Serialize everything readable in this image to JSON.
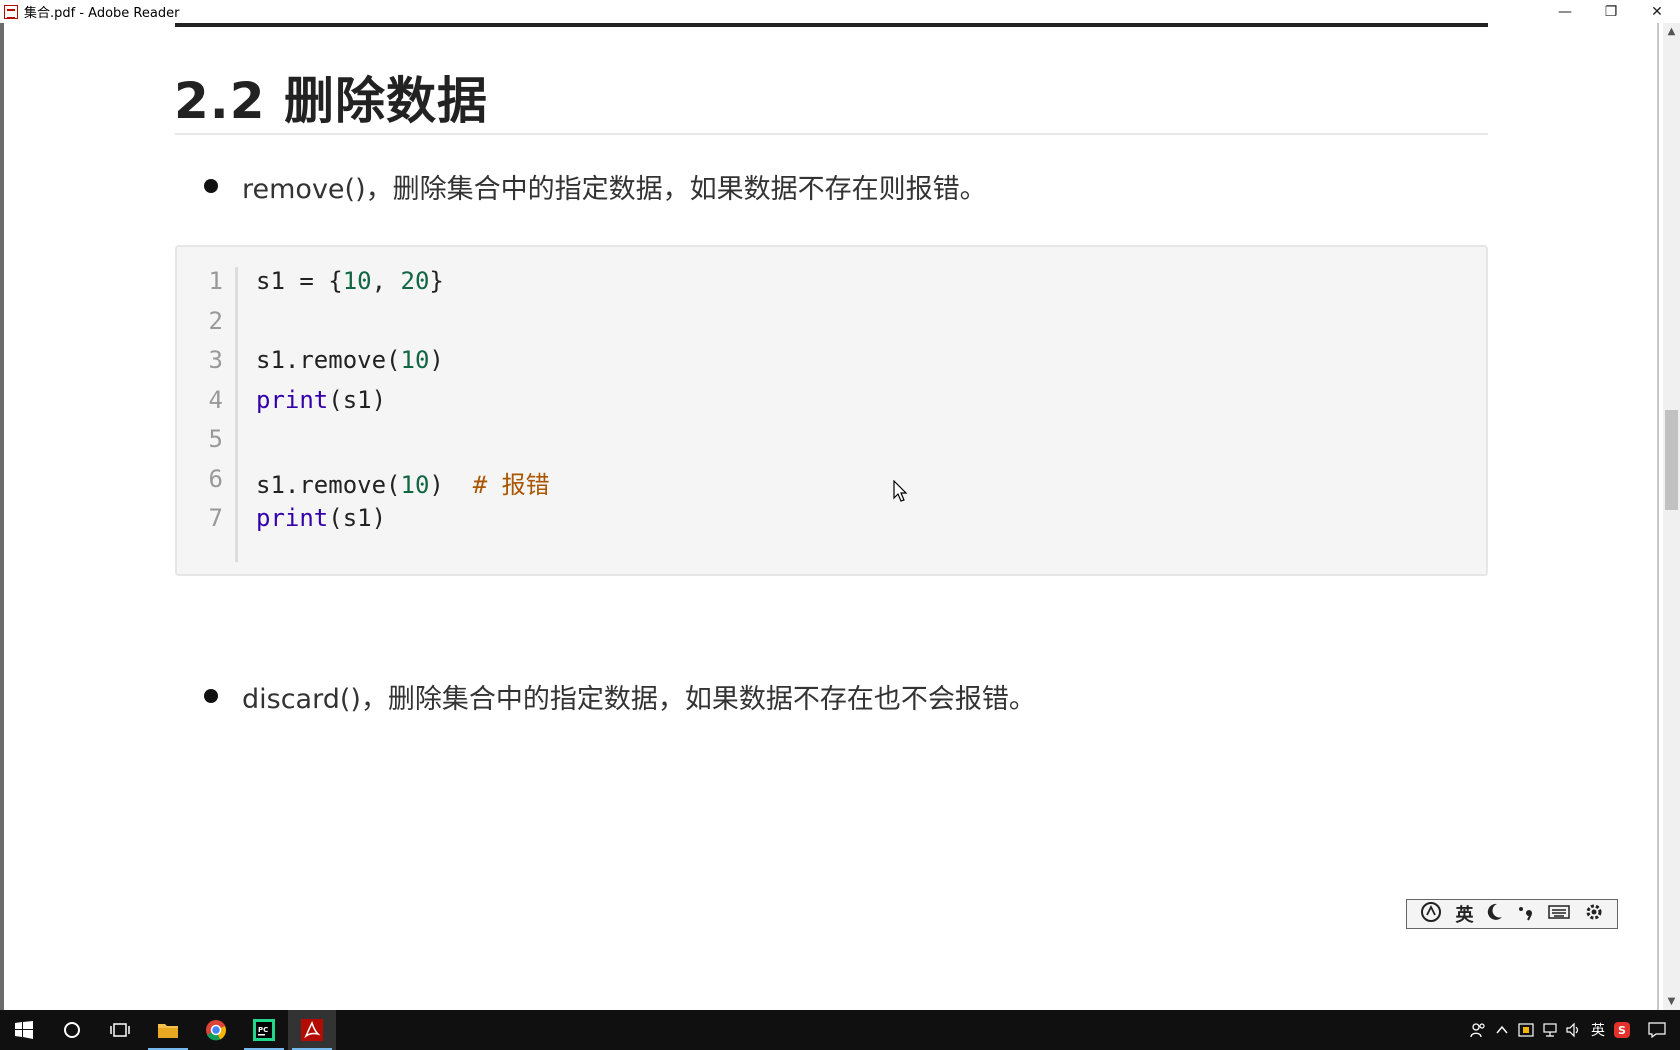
{
  "window": {
    "title": "集合.pdf - Adobe Reader",
    "minimize_glyph": "—",
    "restore_glyph": "❐",
    "close_glyph": "✕"
  },
  "document": {
    "heading": "2.2 删除数据",
    "bullets": [
      "remove()，删除集合中的指定数据，如果数据不存在则报错。",
      "discard()，删除集合中的指定数据，如果数据不存在也不会报错。"
    ],
    "code": {
      "line_numbers": [
        "1",
        "2",
        "3",
        "4",
        "5",
        "6",
        "7"
      ],
      "lines": [
        [
          {
            "t": "s1 = {",
            "c": ""
          },
          {
            "t": "10",
            "c": "num"
          },
          {
            "t": ", ",
            "c": ""
          },
          {
            "t": "20",
            "c": "num"
          },
          {
            "t": "}",
            "c": ""
          }
        ],
        [],
        [
          {
            "t": "s1.remove(",
            "c": ""
          },
          {
            "t": "10",
            "c": "num"
          },
          {
            "t": ")",
            "c": ""
          }
        ],
        [
          {
            "t": "print",
            "c": "builtin"
          },
          {
            "t": "(s1)",
            "c": ""
          }
        ],
        [],
        [
          {
            "t": "s1.remove(",
            "c": ""
          },
          {
            "t": "10",
            "c": "num"
          },
          {
            "t": ")  ",
            "c": ""
          },
          {
            "t": "# 报错",
            "c": "comment"
          }
        ],
        [
          {
            "t": "print",
            "c": "builtin"
          },
          {
            "t": "(s1)",
            "c": ""
          }
        ]
      ]
    }
  },
  "ime_toolbar": {
    "language_label": "英",
    "icons": [
      "ime-logo-icon",
      "moon-icon",
      "punctuation-icon",
      "keyboard-icon",
      "gear-icon"
    ]
  },
  "taskbar": {
    "apps": [
      "start-icon",
      "cortana-icon",
      "task-view-icon",
      "file-explorer-icon",
      "chrome-icon",
      "pycharm-icon",
      "adobe-reader-icon"
    ],
    "tray_lang": "英"
  },
  "colors": {
    "number": "#116644",
    "builtin": "#3300aa",
    "comment": "#aa5500",
    "taskbar": "#101010"
  }
}
